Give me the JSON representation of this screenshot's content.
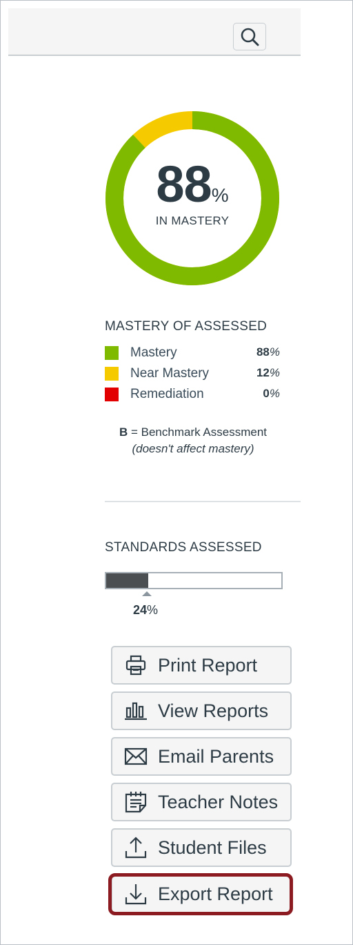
{
  "donut": {
    "value": "88",
    "percent_sign": "%",
    "caption": "IN MASTERY",
    "segments": [
      {
        "label": "Mastery",
        "fraction": 0.88,
        "color": "#7fba00"
      },
      {
        "label": "Near Mastery",
        "fraction": 0.12,
        "color": "#f5cb00"
      }
    ]
  },
  "mastery": {
    "title": "MASTERY OF ASSESSED",
    "items": [
      {
        "label": "Mastery",
        "value": "88",
        "unit": "%",
        "color": "#7fba00"
      },
      {
        "label": "Near Mastery",
        "value": "12",
        "unit": "%",
        "color": "#f5cb00"
      },
      {
        "label": "Remediation",
        "value": "0",
        "unit": "%",
        "color": "#e20000"
      }
    ],
    "benchmark_key": "B",
    "benchmark_text": " = Benchmark Assessment",
    "benchmark_note": "(doesn't affect mastery)"
  },
  "standards": {
    "title": "STANDARDS ASSESSED",
    "value": "24",
    "unit": "%",
    "fraction": 0.24
  },
  "actions": [
    {
      "label": "Print Report",
      "icon": "printer-icon"
    },
    {
      "label": "View Reports",
      "icon": "bar-chart-icon"
    },
    {
      "label": "Email Parents",
      "icon": "envelope-icon"
    },
    {
      "label": "Teacher Notes",
      "icon": "notes-icon"
    },
    {
      "label": "Student Files",
      "icon": "upload-icon"
    },
    {
      "label": "Export Report",
      "icon": "download-icon"
    }
  ]
}
